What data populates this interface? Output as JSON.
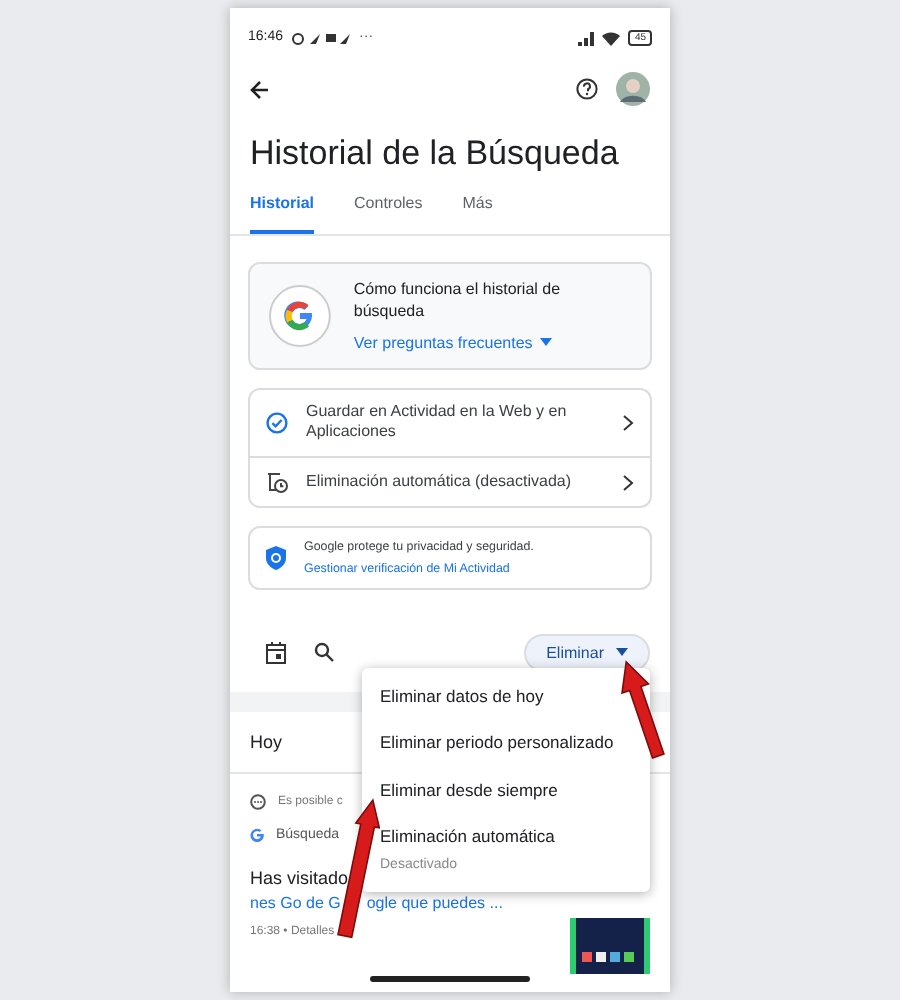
{
  "status_bar": {
    "time": "16:46",
    "more": "···",
    "battery": "45"
  },
  "title": "Historial de la Búsqueda",
  "tabs": [
    {
      "label": "Historial",
      "selected": true
    },
    {
      "label": "Controles",
      "selected": false
    },
    {
      "label": "Más",
      "selected": false
    }
  ],
  "info_card": {
    "text": "Cómo funciona el historial de búsqueda",
    "link": "Ver preguntas frecuentes"
  },
  "settings": [
    {
      "kind": "check",
      "label": "Guardar en Actividad en la Web y en Aplicaciones"
    },
    {
      "kind": "auto-delete",
      "label": "Eliminación automática (desactivada)"
    }
  ],
  "privacy": {
    "text": "Google protege tu privacidad y seguridad.",
    "link": "Gestionar verificación de Mi Actividad"
  },
  "delete_button": "Eliminar",
  "day": "Hoy",
  "history": {
    "notice": "Es posible c",
    "source": "Búsqueda",
    "heading": "Has visitado",
    "link_start": "nes Go de G",
    "link_end": "ogle que puedes ...",
    "meta": "16:38 • Detalles"
  },
  "menu": [
    {
      "label": "Eliminar datos de hoy"
    },
    {
      "label": "Eliminar periodo personalizado"
    },
    {
      "label": "Eliminar desde siempre"
    },
    {
      "label": "Eliminación automática",
      "sub": "Desactivado"
    }
  ]
}
